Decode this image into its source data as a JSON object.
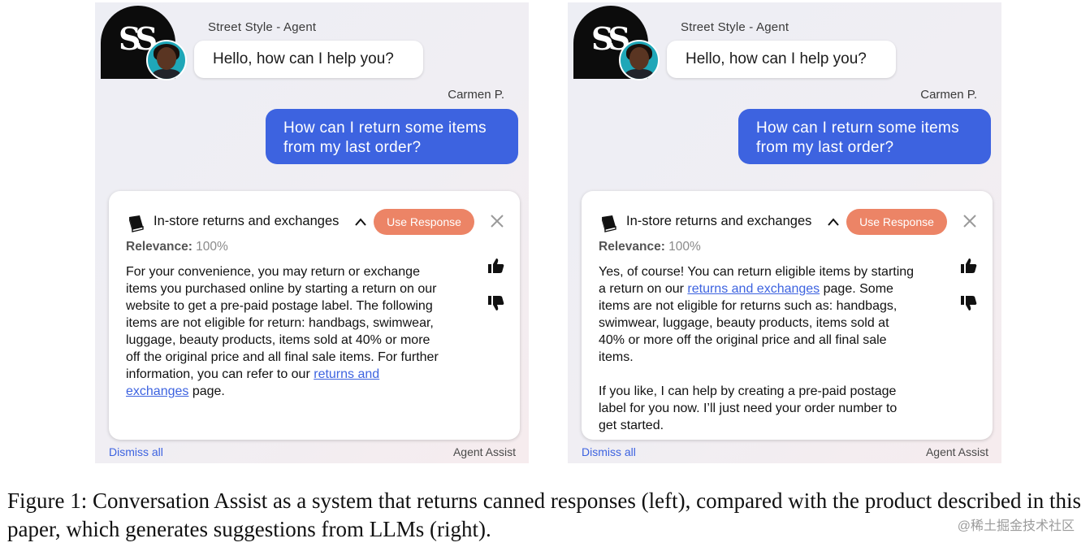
{
  "panels": [
    {
      "agent_name": "Street Style - Agent",
      "logo_text": "SS",
      "agent_message": "Hello, how can I help you?",
      "user_name": "Carmen P.",
      "user_message": "How can I return some items from my last order?",
      "card": {
        "title": "In-store returns and exchanges",
        "use_response_label": "Use Response",
        "relevance_label": "Relevance:",
        "relevance_value": "100%",
        "para1_before": "For your convenience, you may return or exchange items you purchased online by starting a return on our website to get a pre-paid postage label. The following items are not eligible for return: handbags, swimwear, luggage, beauty products, items sold at 40% or more off the original price and all final sale items. For further information, you can refer to our ",
        "para1_link": "returns and exchanges",
        "para1_after": " page."
      },
      "dismiss_label": "Dismiss all",
      "footer_label": "Agent Assist"
    },
    {
      "agent_name": "Street Style - Agent",
      "logo_text": "SS",
      "agent_message": "Hello, how can I help you?",
      "user_name": "Carmen P.",
      "user_message": "How can I return some items from my last order?",
      "card": {
        "title": "In-store returns and exchanges",
        "use_response_label": "Use Response",
        "relevance_label": "Relevance:",
        "relevance_value": "100%",
        "para1_before": "Yes, of course! You can return eligible items by starting a return on our ",
        "para1_link": "returns and exchanges",
        "para1_after": " page. Some items are not eligible for returns such as: handbags, swimwear, luggage, beauty products, items sold at 40% or more off the original price and all final sale items.",
        "para2": "If you like, I can help by creating a pre-paid postage label for you now. I’ll just need your order number to get started."
      },
      "dismiss_label": "Dismiss all",
      "footer_label": "Agent Assist"
    }
  ],
  "caption": "Figure 1: Conversation Assist as a system that returns canned responses (left), compared with the product described in this paper, which generates suggestions from LLMs (right).",
  "watermark": "@稀土掘金技术社区",
  "colors": {
    "user_bubble": "#3d63e0",
    "use_response_button": "#ec8466",
    "link": "#3d63e0"
  },
  "icons": [
    "book-icon",
    "chevron-up-icon",
    "close-icon",
    "thumbs-up-icon",
    "thumbs-down-icon",
    "avatar"
  ]
}
